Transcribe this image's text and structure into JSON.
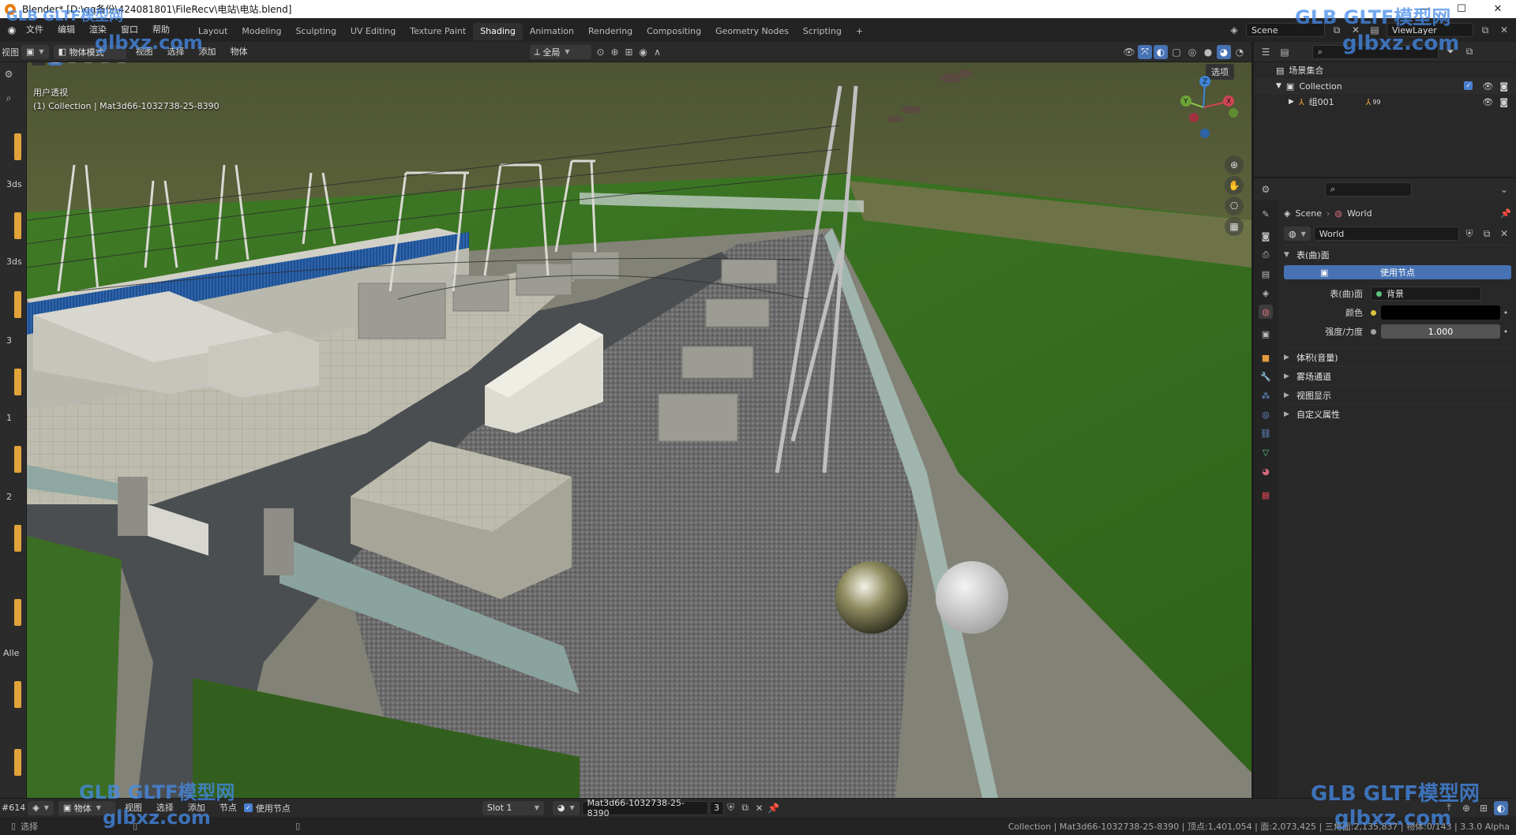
{
  "title_bar": {
    "text": "Blender* [D:\\qq备份\\424081801\\FileRecv\\电站\\电站.blend]",
    "min": "—",
    "max": "☐",
    "close": "✕"
  },
  "top_menu": [
    "文件",
    "编辑",
    "渲染",
    "窗口",
    "帮助"
  ],
  "workspace_tabs": [
    "Layout",
    "Modeling",
    "Sculpting",
    "UV Editing",
    "Texture Paint",
    "Shading",
    "Animation",
    "Rendering",
    "Compositing",
    "Geometry Nodes",
    "Scripting"
  ],
  "active_tab": "Shading",
  "add_tab": "+",
  "scene_selector": "Scene",
  "viewlayer_selector": "ViewLayer",
  "viewport_header": {
    "view_menu": "视图",
    "mode": "物体模式",
    "menus": [
      "视图",
      "选择",
      "添加",
      "物体"
    ],
    "transform_orientation": "全局"
  },
  "viewport": {
    "perspective_label": "用户透视",
    "object_info": "(1) Collection | Mat3d66-1032738-25-8390",
    "options_button": "选项",
    "gizmo_axes": [
      "X",
      "Y",
      "Z"
    ]
  },
  "left_toolbar_labels": [
    "3ds",
    "3ds",
    "3",
    "1",
    "2",
    "Alle"
  ],
  "outliner": {
    "root": "场景集合",
    "collection": "Collection",
    "group": "组001",
    "group_badge": "99"
  },
  "properties": {
    "breadcrumb_scene": "Scene",
    "breadcrumb_world": "World",
    "world_name": "World",
    "surface_section": "表(曲)面",
    "use_nodes_button": "使用节点",
    "surface_label": "表(曲)面",
    "surface_value": "背景",
    "color_label": "颜色",
    "strength_label": "强度/力度",
    "strength_value": "1.000",
    "collapsed_sections": [
      "体积(音量)",
      "雾场通道",
      "视图显示",
      "自定义属性"
    ]
  },
  "bottom_bar": {
    "left_id": "#614",
    "mode": "物体",
    "menus": [
      "视图",
      "选择",
      "添加",
      "节点"
    ],
    "use_nodes_label": "使用节点",
    "slot": "Slot 1",
    "material": "Mat3d66-1032738-25-8390",
    "user_count": "3"
  },
  "status_bar": {
    "left": "选择",
    "right": "Collection | Mat3d66-1032738-25-8390 | 顶点:1,401,054 | 面:2,073,425 | 三角面:2,135,837 | 物体:0/143 | 3.3.0 Alpha"
  },
  "watermarks": {
    "brand": "GLB GLTF模型网",
    "site": "glbxz.com"
  },
  "colors": {
    "accent_blue": "#4772b3",
    "active_tool": "#e2a33a",
    "color_swatch": "#000000"
  }
}
